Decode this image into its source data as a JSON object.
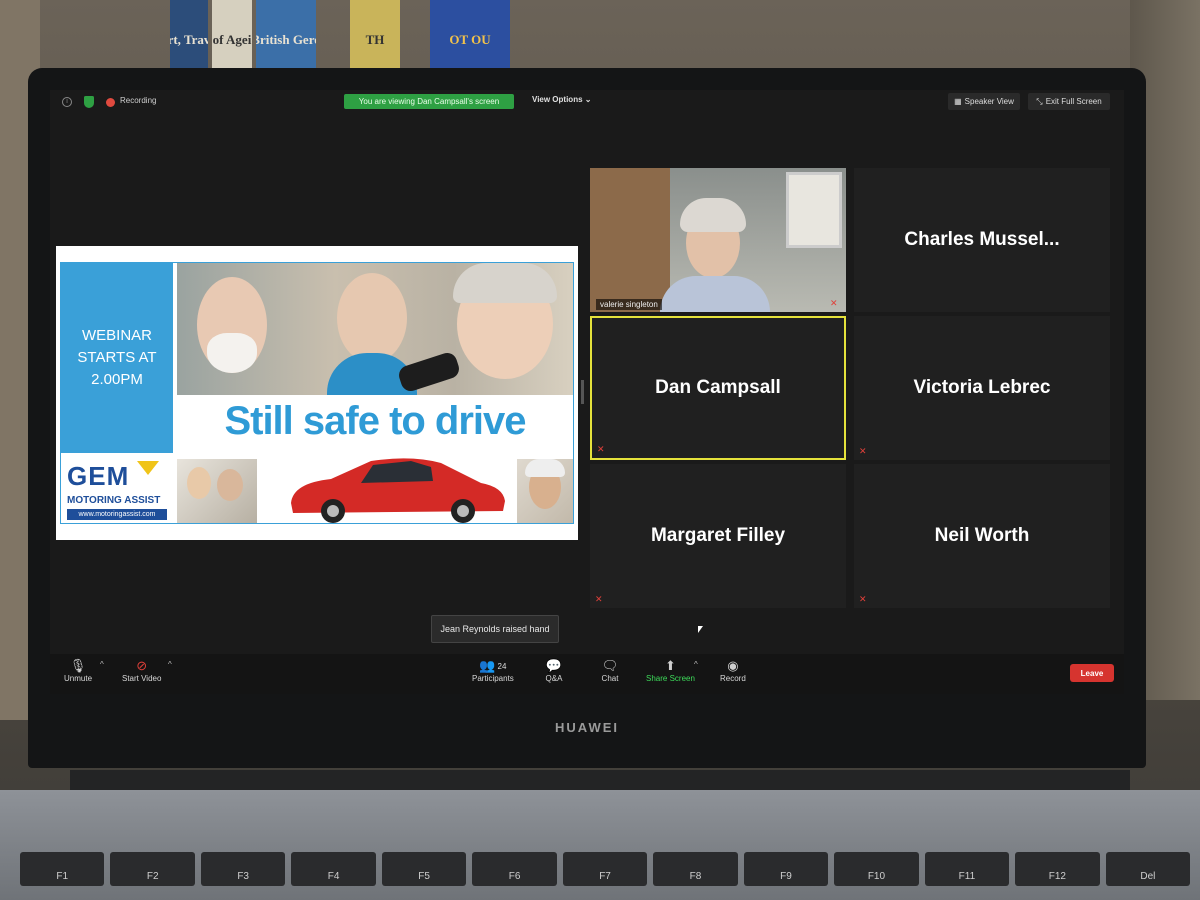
{
  "topbar": {
    "recording_label": "Recording",
    "viewing_text": "You are viewing Dan Campsall's screen",
    "view_options": "View Options",
    "speaker_view": "Speaker View",
    "exit_full_screen": "Exit Full Screen"
  },
  "slide": {
    "webinar_text": "WEBINAR STARTS AT 2.00PM",
    "headline": "Still safe to drive",
    "logo_text": "GEM",
    "logo_sub": "MOTORING ASSIST",
    "logo_url": "www.motoringassist.com"
  },
  "gallery": {
    "video_participant": "valerie singleton",
    "tiles": [
      {
        "name": "Charles  Mussel..."
      },
      {
        "name": "Dan Campsall"
      },
      {
        "name": "Victoria Lebrec"
      },
      {
        "name": "Margaret Filley"
      },
      {
        "name": "Neil Worth"
      }
    ]
  },
  "notification": "Jean Reynolds raised hand",
  "toolbar": {
    "unmute": "Unmute",
    "start_video": "Start Video",
    "participants": "Participants",
    "participants_count": "24",
    "qa": "Q&A",
    "chat": "Chat",
    "share_screen": "Share Screen",
    "record": "Record",
    "leave": "Leave"
  },
  "device": {
    "brand": "HUAWEI",
    "keys": [
      "F1",
      "F2",
      "F3",
      "F4",
      "F5",
      "F6",
      "F7",
      "F8",
      "F9",
      "F10",
      "F11",
      "F12",
      "Del"
    ]
  },
  "shelf": {
    "books": [
      "rt, Trav",
      "of Agei",
      "British Gero",
      "TH",
      "OT OU"
    ]
  }
}
